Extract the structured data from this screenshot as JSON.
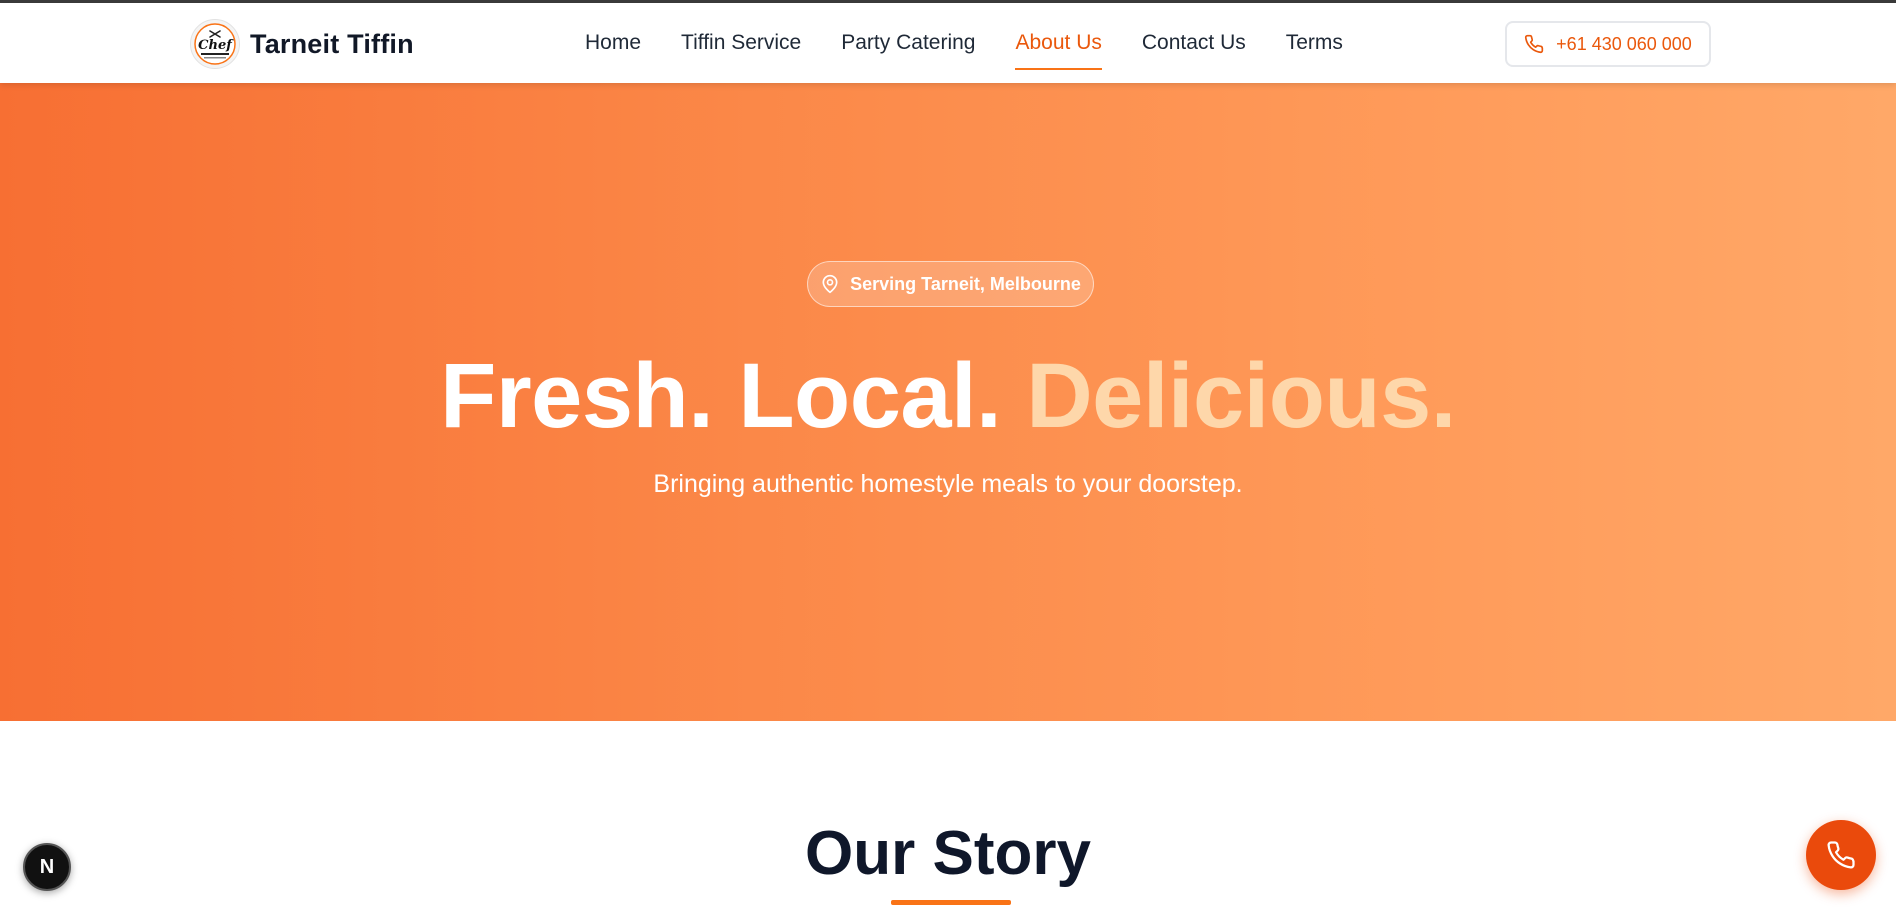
{
  "brand": {
    "name": "Tarneit Tiffin",
    "logo_text": "Chef"
  },
  "nav": {
    "items": [
      {
        "label": "Home"
      },
      {
        "label": "Tiffin Service"
      },
      {
        "label": "Party Catering"
      },
      {
        "label": "About Us",
        "active": true
      },
      {
        "label": "Contact Us"
      },
      {
        "label": "Terms"
      }
    ]
  },
  "header": {
    "phone_label": "+61 430 060 000",
    "phone_icon": "phone-icon"
  },
  "hero": {
    "location_label": "Serving Tarneit, Melbourne",
    "location_icon": "map-pin-icon",
    "title_part1": "Fresh. Local. ",
    "title_accent": "Delicious.",
    "subtitle": "Bringing authentic homestyle meals to your doorstep."
  },
  "story": {
    "title": "Our Story"
  },
  "floating": {
    "next_badge_label": "N",
    "call_icon": "phone-icon"
  },
  "colors": {
    "accent": "#ea580c",
    "hero_gradient_start": "#f76f33",
    "hero_gradient_end": "#ffa868",
    "title_accent": "#fed7aa",
    "heading_dark": "#0f172a"
  }
}
